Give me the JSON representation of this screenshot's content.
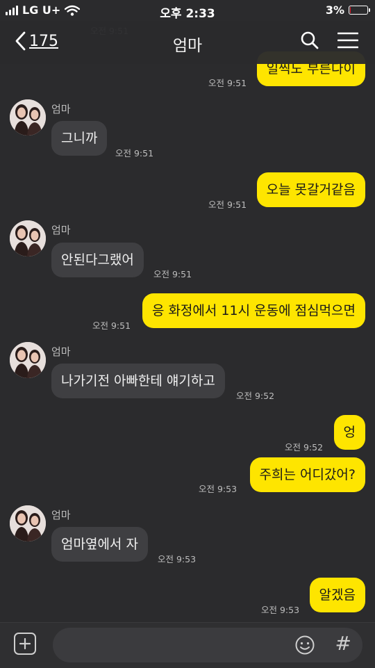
{
  "status_bar": {
    "carrier": "LG U+",
    "time": "오후 2:33",
    "battery_percent": "3%",
    "battery_level": 0.03
  },
  "header": {
    "back_count": "175",
    "title": "엄마"
  },
  "sender_name": "엄마",
  "messages": [
    {
      "dir": "out",
      "text": "일찍도 부른다이",
      "time": "오전 9:51"
    },
    {
      "dir": "in",
      "text": "그니까",
      "time": "오전 9:51"
    },
    {
      "dir": "out",
      "text": "오늘 못갈거같음",
      "time": "오전 9:51"
    },
    {
      "dir": "in",
      "text": "안된다그랬어",
      "time": "오전 9:51"
    },
    {
      "dir": "out",
      "text": "응 화정에서 11시 운동에 점심먹으면",
      "time": "오전 9:51"
    },
    {
      "dir": "in",
      "text": "나가기전 아빠한테 얘기하고",
      "time": "오전 9:52"
    },
    {
      "dir": "out",
      "text": "엉",
      "time": "오전 9:52"
    },
    {
      "dir": "out",
      "text": "주희는 어디갔어?",
      "time": "오전 9:53"
    },
    {
      "dir": "in",
      "text": "엄마옆에서 자",
      "time": "오전 9:53"
    },
    {
      "dir": "out",
      "text": "알겠음",
      "time": "오전 9:53"
    }
  ],
  "input": {
    "value": "",
    "hash_label": "#"
  },
  "colors": {
    "background": "#2b2b2d",
    "out_bubble": "#fee500",
    "in_bubble": "#3f3f42"
  }
}
